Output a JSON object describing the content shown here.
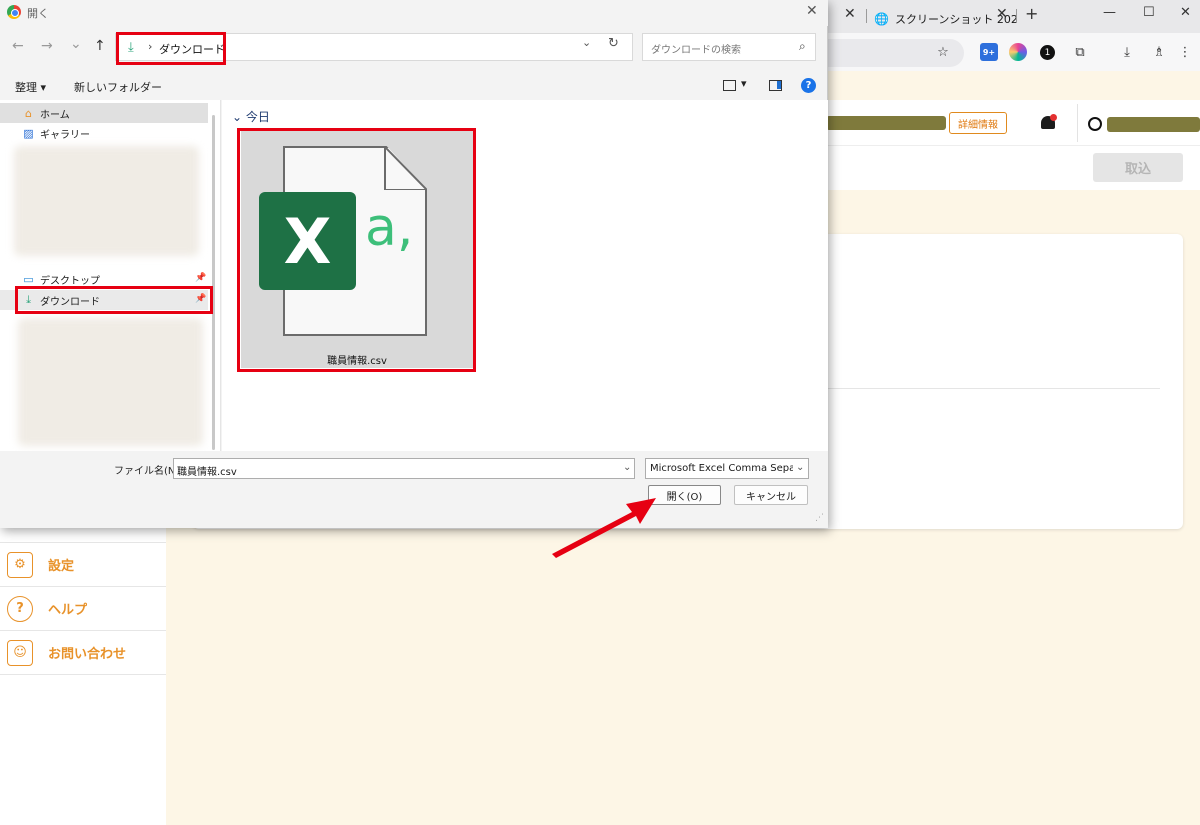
{
  "browser": {
    "tabs": [
      {
        "title": "",
        "close": "✕"
      },
      {
        "title": "スクリーンショット 202",
        "close": "✕"
      }
    ],
    "new_tab": "+",
    "window_controls": {
      "minimize": "—",
      "maximize": "☐",
      "close": "✕"
    },
    "toolbar_icons": [
      "star-icon",
      "extension-badge-icon",
      "color-picker-icon",
      "password-manager-icon",
      "extensions-icon",
      "download-icon",
      "account-icon"
    ],
    "badge_count": "9+",
    "password_badge": "1"
  },
  "app": {
    "detail_button": "詳細情報",
    "import_button": "取込",
    "sidebar": [
      {
        "label": "設定",
        "icon": "gear-icon",
        "glyph": "⚙"
      },
      {
        "label": "ヘルプ",
        "icon": "question-icon",
        "glyph": "?"
      },
      {
        "label": "お問い合わせ",
        "icon": "support-agent-icon",
        "glyph": "☺"
      }
    ],
    "accent_color": "#e8922a"
  },
  "dialog": {
    "title": "開く",
    "close": "✕",
    "nav": {
      "back": "←",
      "forward": "→",
      "recent": "⌄",
      "up": "↑"
    },
    "address": {
      "separator": "›",
      "location": "ダウンロード",
      "refresh": "↻",
      "chevron": "⌄"
    },
    "search_placeholder": "ダウンロードの検索",
    "commands": {
      "organize": "整理 ▾",
      "new_folder": "新しいフォルダー",
      "view_dropdown": "▾",
      "help": "?"
    },
    "nav_pane": {
      "home": "ホーム",
      "gallery": "ギャラリー",
      "desktop": "デスクトップ",
      "downloads": "ダウンロード"
    },
    "group_header": "今日",
    "file": {
      "name": "職員情報.csv",
      "icon_letter": "X",
      "icon_suffix": "a,"
    },
    "file_name_label": "ファイル名(N):",
    "file_name_value": "職員情報.csv",
    "file_type": "Microsoft Excel Comma Separated Values File",
    "open_button": "開く(O)",
    "cancel_button": "キャンセル"
  },
  "annotation_color": "#e60012"
}
